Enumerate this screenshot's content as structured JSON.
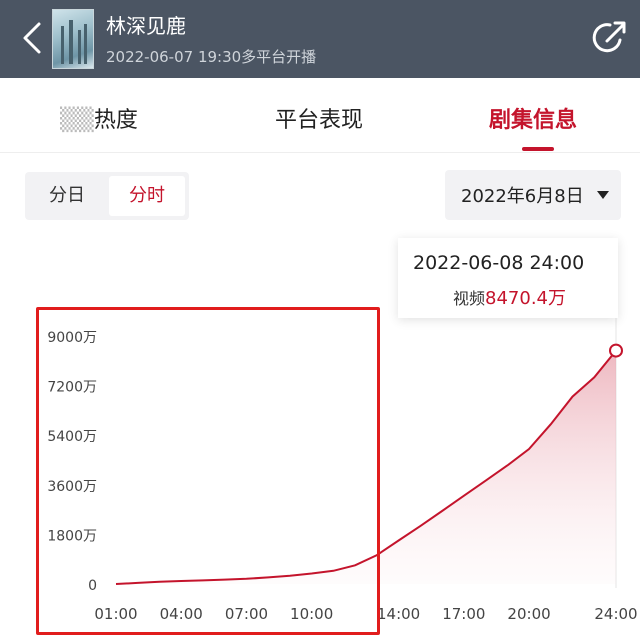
{
  "header": {
    "title": "林深见鹿",
    "subtitle": "2022-06-07 19:30多平台开播"
  },
  "tabs": [
    {
      "label": "热度",
      "active": false
    },
    {
      "label": "平台表现",
      "active": false
    },
    {
      "label": "剧集信息",
      "active": true
    }
  ],
  "granularity": {
    "options": [
      "分日",
      "分时"
    ],
    "selected": "分时"
  },
  "date_select": {
    "value": "2022年6月8日"
  },
  "tooltip": {
    "datetime": "2022-06-08 24:00",
    "metric": "视频",
    "value": "8470.4万"
  },
  "colors": {
    "accent": "#c4142c",
    "header_bg": "#4b5563",
    "highlight_box": "#e11d1d"
  },
  "chart_data": {
    "type": "area",
    "x": [
      "01:00",
      "02:00",
      "03:00",
      "04:00",
      "05:00",
      "06:00",
      "07:00",
      "08:00",
      "09:00",
      "10:00",
      "11:00",
      "12:00",
      "13:00",
      "14:00",
      "15:00",
      "16:00",
      "17:00",
      "18:00",
      "19:00",
      "20:00",
      "21:00",
      "22:00",
      "23:00",
      "24:00"
    ],
    "series": [
      {
        "name": "视频",
        "values": [
          0,
          40,
          80,
          110,
          130,
          160,
          190,
          240,
          300,
          380,
          480,
          680,
          1050,
          1580,
          2100,
          2650,
          3200,
          3750,
          4300,
          4900,
          5800,
          6800,
          7500,
          8470.4
        ]
      }
    ],
    "xticks": [
      "01:00",
      "04:00",
      "07:00",
      "10:00",
      "14:00",
      "17:00",
      "20:00",
      "24:00"
    ],
    "yticks": [
      "0",
      "1800万",
      "3600万",
      "5400万",
      "7200万",
      "9000万"
    ],
    "ylim": [
      0,
      9000
    ],
    "grid": false,
    "highlight_point": {
      "x": "24:00",
      "value": 8470.4
    }
  }
}
